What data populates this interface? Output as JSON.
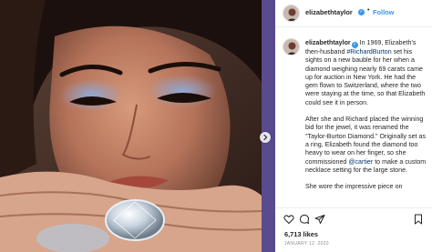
{
  "post": {
    "username": "elizabethtaylor",
    "verified_glyph": "✓",
    "separator": "•",
    "follow_label": "Follow",
    "caption": {
      "p1_start": "In 1969, Elizabeth's then-husband ",
      "p1_link": "#RichardBurton",
      "p1_end": " set his sights on a new bauble for her when a diamond weighing nearly 69 carats came up for auction in New York. He had the gem flown to Switzerland, where the two were staying at the time, so that Elizabeth could see it in person.",
      "p2_start": "After she and Richard placed the winning bid for the jewel, it was renamed the \"Taylor-Burton Diamond.\" Originally set as a ring, Elizabeth found the diamond too heavy to wear on her finger, so she commissioned ",
      "p2_link": "@cartier",
      "p2_end": " to make a custom necklace setting for the large stone.",
      "p3_start": "She wore the impressive piece on"
    },
    "likes": "6,713 likes",
    "date": "JANUARY 12, 2020"
  },
  "icons": {
    "like": "heart-icon",
    "comment": "comment-icon",
    "share": "share-icon",
    "save": "bookmark-icon",
    "next": "chevron-right-icon"
  },
  "colors": {
    "background": "#5a4a8e",
    "link": "#00376b",
    "follow": "#3897f0",
    "verified": "#3897f0"
  }
}
